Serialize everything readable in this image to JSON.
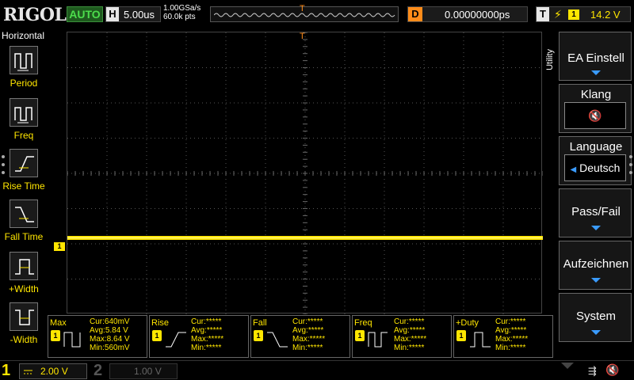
{
  "topbar": {
    "brand": "RIGOL",
    "run_state": "AUTO",
    "horizontal_label": "H",
    "timebase": "5.00us",
    "sample_rate": "1.00GSa/s",
    "memory_depth": "60.0k pts",
    "trigger_pos_marker": "T",
    "delay_label": "D",
    "delay_value": "0.00000000ps",
    "trigger_label": "T",
    "trigger_source": "1",
    "trigger_level": "14.2 V"
  },
  "left_menu": {
    "title": "Horizontal",
    "items": [
      {
        "label": "Period",
        "icon": "period-icon"
      },
      {
        "label": "Freq",
        "icon": "freq-icon"
      },
      {
        "label": "Rise Time",
        "icon": "rise-time-icon"
      },
      {
        "label": "Fall Time",
        "icon": "fall-time-icon"
      },
      {
        "label": "+Width",
        "icon": "pos-width-icon"
      },
      {
        "label": "-Width",
        "icon": "neg-width-icon"
      }
    ]
  },
  "right_menu": {
    "tab_label": "Utility",
    "buttons": [
      {
        "label": "EA Einstell"
      },
      {
        "label": "Klang",
        "sub": "🔇"
      },
      {
        "label": "Language",
        "sub": "Deutsch"
      },
      {
        "label": "Pass/Fail"
      },
      {
        "label": "Aufzeichnen"
      },
      {
        "label": "System"
      }
    ]
  },
  "screen": {
    "channel_marker": "1",
    "trace_color": "#ffe600",
    "trigger_color": "#ff8c1a"
  },
  "measurements": [
    {
      "name": "Max",
      "ch": "1",
      "cur": "Cur:640mV",
      "avg": "Avg:5.84 V",
      "max": "Max:8.64 V",
      "min": "Min:560mV"
    },
    {
      "name": "Rise",
      "ch": "1",
      "cur": "Cur:*****",
      "avg": "Avg:*****",
      "max": "Max:*****",
      "min": "Min:*****"
    },
    {
      "name": "Fall",
      "ch": "1",
      "cur": "Cur:*****",
      "avg": "Avg:*****",
      "max": "Max:*****",
      "min": "Min:*****"
    },
    {
      "name": "Freq",
      "ch": "1",
      "cur": "Cur:*****",
      "avg": "Avg:*****",
      "max": "Max:*****",
      "min": "Min:*****"
    },
    {
      "name": "+Duty",
      "ch": "1",
      "cur": "Cur:*****",
      "avg": "Avg:*****",
      "max": "Max:*****",
      "min": "Min:*****"
    }
  ],
  "bottombar": {
    "ch1_number": "1",
    "ch1_scale": "2.00 V",
    "ch2_number": "2",
    "ch2_scale": "1.00 V"
  }
}
